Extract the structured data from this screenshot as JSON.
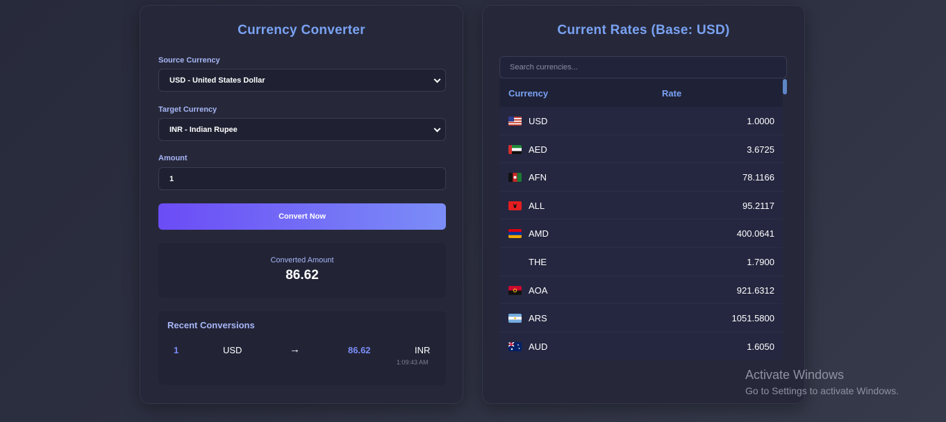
{
  "converter": {
    "title": "Currency Converter",
    "source_label": "Source Currency",
    "source_value": "USD - United States Dollar",
    "target_label": "Target Currency",
    "target_value": "INR - Indian Rupee",
    "amount_label": "Amount",
    "amount_value": "1",
    "convert_button": "Convert Now",
    "result_label": "Converted Amount",
    "result_value": "86.62"
  },
  "recent": {
    "title": "Recent Conversions",
    "items": [
      {
        "amount": "1",
        "from": "USD",
        "arrow": "→",
        "result": "86.62",
        "to": "INR",
        "time": "1:09:43 AM"
      }
    ]
  },
  "rates": {
    "title": "Current Rates (Base: USD)",
    "search_placeholder": "Search currencies...",
    "col_currency": "Currency",
    "col_rate": "Rate",
    "rows": [
      {
        "code": "USD",
        "rate": "1.0000",
        "flag": "us-flag-icon"
      },
      {
        "code": "AED",
        "rate": "3.6725",
        "flag": "uae-flag-icon"
      },
      {
        "code": "AFN",
        "rate": "78.1166",
        "flag": "afghanistan-flag-icon"
      },
      {
        "code": "ALL",
        "rate": "95.2117",
        "flag": "albania-flag-icon"
      },
      {
        "code": "AMD",
        "rate": "400.0641",
        "flag": "armenia-flag-icon"
      },
      {
        "code": "THE",
        "rate": "1.7900",
        "flag": ""
      },
      {
        "code": "AOA",
        "rate": "921.6312",
        "flag": "angola-flag-icon"
      },
      {
        "code": "ARS",
        "rate": "1051.5800",
        "flag": "argentina-flag-icon"
      },
      {
        "code": "AUD",
        "rate": "1.6050",
        "flag": "australia-flag-icon"
      }
    ]
  },
  "watermark": {
    "line1": "Activate Windows",
    "line2": "Go to Settings to activate Windows."
  }
}
